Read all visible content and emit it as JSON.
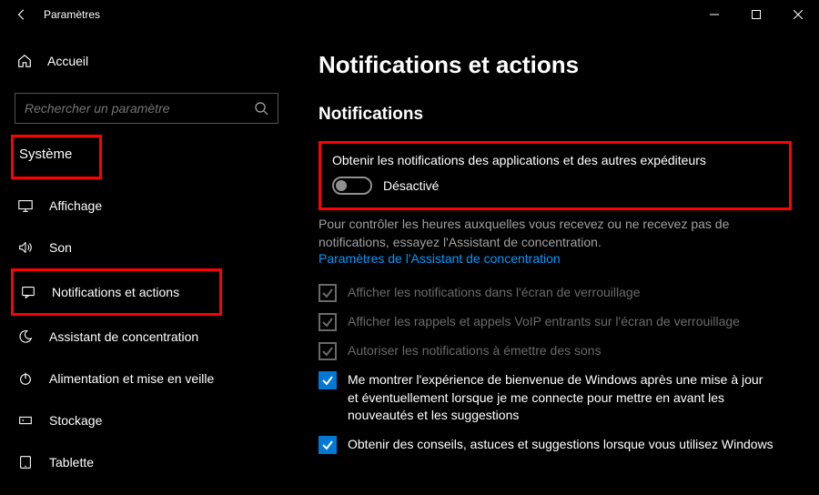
{
  "titlebar": {
    "title": "Paramètres"
  },
  "sidebar": {
    "home": "Accueil",
    "search_placeholder": "Rechercher un paramètre",
    "category": "Système",
    "items": [
      {
        "label": "Affichage"
      },
      {
        "label": "Son"
      },
      {
        "label": "Notifications et actions"
      },
      {
        "label": "Assistant de concentration"
      },
      {
        "label": "Alimentation et mise en veille"
      },
      {
        "label": "Stockage"
      },
      {
        "label": "Tablette"
      }
    ]
  },
  "content": {
    "h1": "Notifications et actions",
    "h2": "Notifications",
    "main_toggle": {
      "label": "Obtenir les notifications des applications et des autres expéditeurs",
      "state": "Désactivé"
    },
    "desc": "Pour contrôler les heures auxquelles vous recevez ou ne recevez pas de notifications, essayez l'Assistant de concentration.",
    "link": "Paramètres de l'Assistant de concentration",
    "options": [
      {
        "label": "Afficher les notifications dans l'écran de verrouillage"
      },
      {
        "label": "Afficher les rappels et appels VoIP entrants sur l'écran de verrouillage"
      },
      {
        "label": "Autoriser les notifications à émettre des sons"
      },
      {
        "label": "Me montrer l'expérience de bienvenue de Windows après une mise à jour et éventuellement lorsque je me connecte pour mettre en avant les nouveautés et les suggestions"
      },
      {
        "label": "Obtenir des conseils, astuces et suggestions lorsque vous utilisez Windows"
      }
    ]
  }
}
